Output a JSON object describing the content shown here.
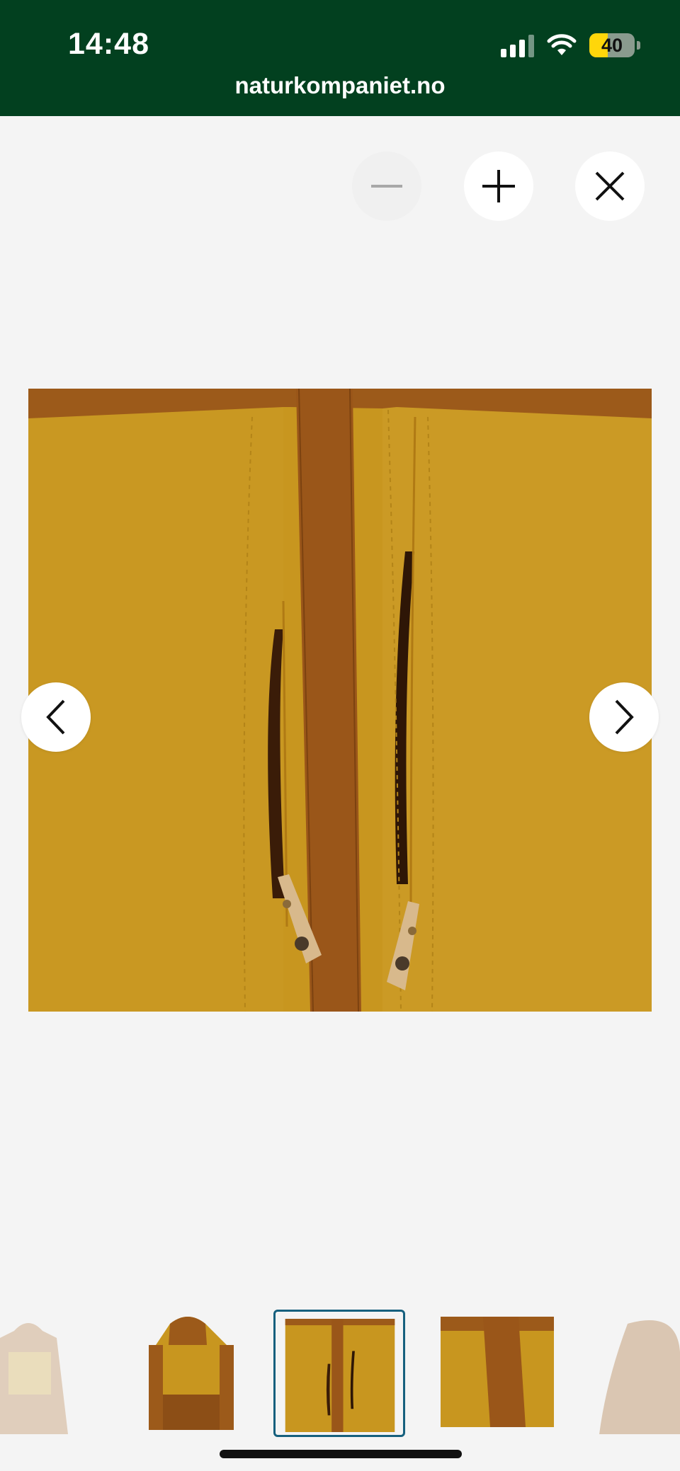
{
  "status_bar": {
    "time": "14:48",
    "battery_level": "40",
    "battery_fraction": 0.4
  },
  "browser": {
    "url": "naturkompaniet.no"
  },
  "controls": {
    "zoom_out_icon": "minus-icon",
    "zoom_in_icon": "plus-icon",
    "close_icon": "close-icon",
    "prev_icon": "chevron-left-icon",
    "next_icon": "chevron-right-icon"
  },
  "gallery": {
    "active_index": 2,
    "thumbnails": [
      "jacket-front-faded",
      "jacket-back",
      "pocket-detail",
      "sleeve-detail",
      "hood-detail"
    ]
  },
  "colors": {
    "header": "#02401f",
    "jacket_main": "#c8961f",
    "jacket_trim": "#9c5a1a",
    "active_thumb_border": "#16607e"
  }
}
